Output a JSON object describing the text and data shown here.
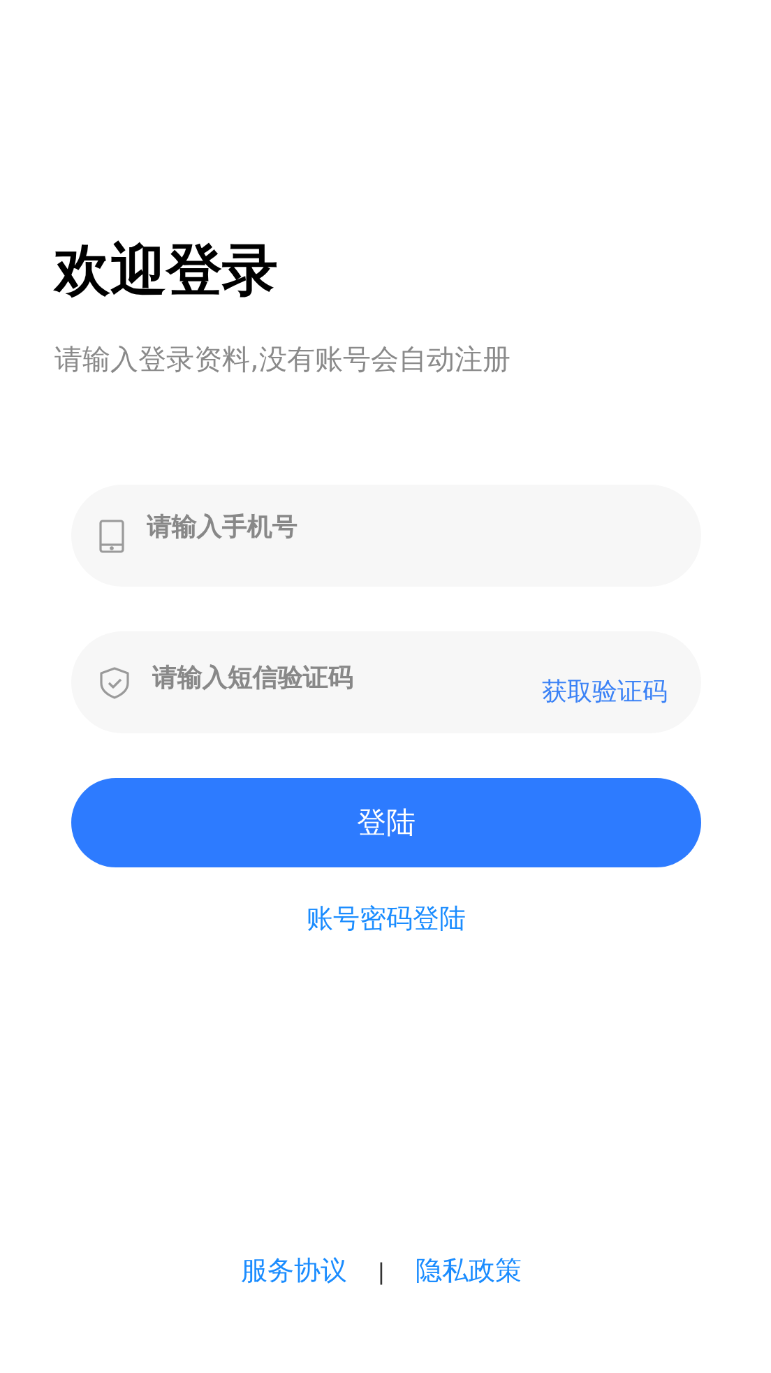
{
  "title": "欢迎登录",
  "subtitle": "请输入登录资料,没有账号会自动注册",
  "fields": [
    {
      "kind": "phone",
      "placeholder": "请输入手机号"
    },
    {
      "kind": "code",
      "placeholder": "请输入短信验证码",
      "action": "获取验证码"
    }
  ],
  "login_button": "登陆",
  "alt_login_link": "账号密码登陆",
  "footer": {
    "links": [
      "服务协议",
      "隐私政策"
    ],
    "separator": "|"
  }
}
